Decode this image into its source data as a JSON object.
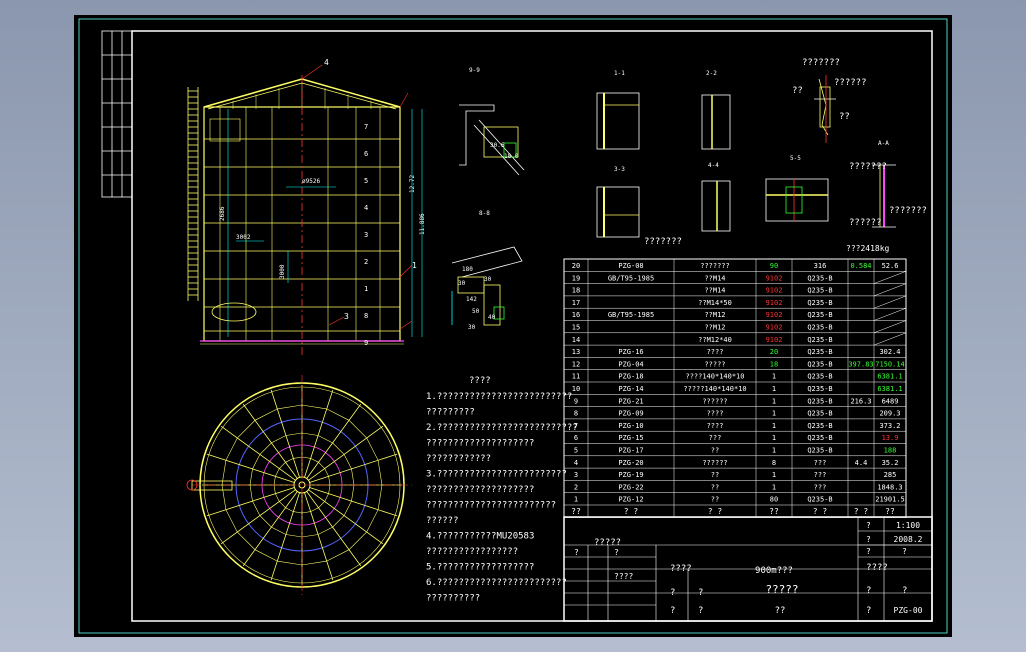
{
  "colors": {
    "background": "#8b97ae",
    "sheet": "#000000",
    "frame": "#ffffff",
    "border": "#4fd1c5",
    "yellow": "#ffff66",
    "cyan": "#00ffff",
    "red": "#ff3333",
    "green": "#33ff33",
    "blue": "#5566ff",
    "magenta": "#ff44ff"
  },
  "elevation": {
    "tag_top": "4",
    "dim_left_1": "2686",
    "dim_left_2": "3002",
    "dim_left_3": "3000",
    "dim_mid": "ø9526",
    "dim_right_1": "12.72",
    "dim_right_2": "11.886",
    "tag_side": "1",
    "tag_bottom": "3",
    "rings": [
      "7",
      "6",
      "5",
      "4",
      "3",
      "2",
      "1",
      "8",
      "9"
    ]
  },
  "section_titles": {
    "a": "A-A",
    "s1": "1-1",
    "s2": "2-2",
    "s3": "3-3",
    "s4": "4-4",
    "s5": "5-5",
    "s6": "6-6",
    "s7": "7-7",
    "s8": "8-8",
    "s9": "9-9"
  },
  "details": {
    "d1": "30.6",
    "d2": "18.0",
    "d3": "180",
    "d4": "30",
    "d5": "30",
    "d6": "142",
    "d7": "50",
    "d8": "30",
    "d9": "40",
    "q1": "???????",
    "q2": "??",
    "q3": "??????",
    "q4": "??",
    "q5": "???????",
    "q6": "???????",
    "q7": "???????",
    "q8": "??????",
    "weight": "???2418kg"
  },
  "notes": {
    "title": "????",
    "lines": [
      "1.?????????????????????????",
      "  ?????????",
      "2.??????????????????????????",
      "  ????????????????????",
      "  ????????????",
      "3.????????????????????????",
      "  ????????????????????",
      "  ????????????????????????",
      "  ??????",
      "4.???????????MU20583",
      "  ?????????????????",
      "5.??????????????????",
      "6.????????????????????????",
      "  ??????????"
    ],
    "side": "?????"
  },
  "bom": {
    "rows": [
      [
        "20",
        "PZG-08",
        "???????",
        "90",
        "316",
        "0.584",
        "52.6"
      ],
      [
        "19",
        "GB/T95-1985",
        "??M14",
        "9102",
        "Q235-B",
        "",
        ""
      ],
      [
        "18",
        "",
        "??M14",
        "9102",
        "Q235-B",
        "",
        ""
      ],
      [
        "17",
        "",
        "??M14*50",
        "9102",
        "Q235-B",
        "",
        ""
      ],
      [
        "16",
        "GB/T95-1985",
        "??M12",
        "9102",
        "Q235-B",
        "",
        ""
      ],
      [
        "15",
        "",
        "??M12",
        "9102",
        "Q235-B",
        "",
        ""
      ],
      [
        "14",
        "",
        "??M12*40",
        "9102",
        "Q235-B",
        "",
        ""
      ],
      [
        "13",
        "PZG-16",
        "????",
        "20",
        "Q235-B",
        "",
        "302.4"
      ],
      [
        "12",
        "PZG-04",
        "?????",
        "18",
        "Q235-B",
        "397.83",
        "7150.14"
      ],
      [
        "11",
        "PZG-18",
        "????140*140*10",
        "1",
        "Q235-B",
        "",
        "6381.1"
      ],
      [
        "10",
        "PZG-14",
        "?????140*140*10",
        "1",
        "Q235-B",
        "",
        "6381.1"
      ],
      [
        "9",
        "PZG-21",
        "??????",
        "1",
        "Q235-B",
        "216.3",
        "6489"
      ],
      [
        "8",
        "PZG-09",
        "????",
        "1",
        "Q235-B",
        "",
        "209.3"
      ],
      [
        "7",
        "PZG-10",
        "????",
        "1",
        "Q235-B",
        "",
        "373.2"
      ],
      [
        "6",
        "PZG-15",
        "???",
        "1",
        "Q235-B",
        "",
        "13.9"
      ],
      [
        "5",
        "PZG-17",
        "??",
        "1",
        "Q235-B",
        "",
        "188"
      ],
      [
        "4",
        "PZG-20",
        "??????",
        "8",
        "???",
        "4.4",
        "35.2"
      ],
      [
        "3",
        "PZG-19",
        "??",
        "1",
        "???",
        "",
        "285"
      ],
      [
        "2",
        "PZG-22",
        "??",
        "1",
        "???",
        "",
        "1848.3"
      ],
      [
        "1",
        "PZG-12",
        "??",
        "80",
        "Q235-B",
        "",
        "21901.5"
      ]
    ],
    "header": [
      "??",
      "? ?",
      "? ?",
      "??",
      "? ?",
      "? ?",
      "??"
    ]
  },
  "title_block": {
    "scale_label": "?",
    "scale": "1:100",
    "date_label": "?",
    "date": "2008.2",
    "sheet_label": "?",
    "sheet": "?",
    "project": "900m???",
    "company": "????",
    "drawing_title": "?????",
    "drawing_no": "PZG-00",
    "sign1": "?",
    "sign2": "?",
    "sign3": "?",
    "sign4": "?",
    "sign5": "?",
    "role1": "????",
    "role2": "?",
    "role3": "?",
    "role4": "??",
    "cell_a": "?",
    "cell_b": "?",
    "cell_c": "????"
  }
}
